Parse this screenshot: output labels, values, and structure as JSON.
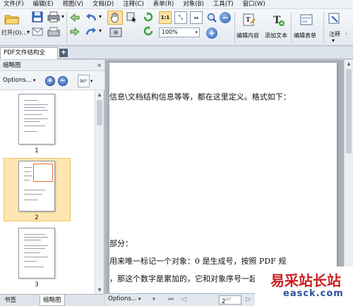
{
  "menu": [
    "文件(F)",
    "编辑(E)",
    "视图(V)",
    "文档(D)",
    "注释(C)",
    "表单(R)",
    "对象(B)",
    "工具(T)",
    "窗口(W)"
  ],
  "toolbar": {
    "open_label": "打开(O)...",
    "zoom_value": "100%",
    "edit_content_label": "编辑内容",
    "add_text_label": "添加文本",
    "edit_form_label": "编辑表单",
    "annotate_label": "注释"
  },
  "tab": {
    "title": "PDF文件结构全",
    "new_tab_icon": "+"
  },
  "thumbnail_panel": {
    "title": "缩略图",
    "close_icon": "×",
    "options_label": "Options...",
    "rotate_label": "90°",
    "pages": [
      {
        "number": "1",
        "selected": false
      },
      {
        "number": "2",
        "selected": true
      },
      {
        "number": "3",
        "selected": false
      }
    ]
  },
  "bottom_tabs": {
    "bookmarks": "书签",
    "thumbnails": "缩略图"
  },
  "document": {
    "line1": "信息\\文档结构信息等等，都在这里定义。格式如下：",
    "line2": "部分：",
    "line3": "用来唯一标记一个对象：0 是生成号，按照 PDF 规",
    "line4": "，那这个数字是累加的，它和对象序号一起标"
  },
  "navbar": {
    "options_label": "Options...",
    "current_page": "2",
    "total_pages": "/17"
  },
  "watermark": {
    "text": "易采站长站",
    "url": "easck.com"
  },
  "colors": {
    "accent": "#2b5fb5",
    "selection": "#fde6b0",
    "selection_border": "#f06c2e",
    "watermark_red": "#cc1f1f"
  }
}
